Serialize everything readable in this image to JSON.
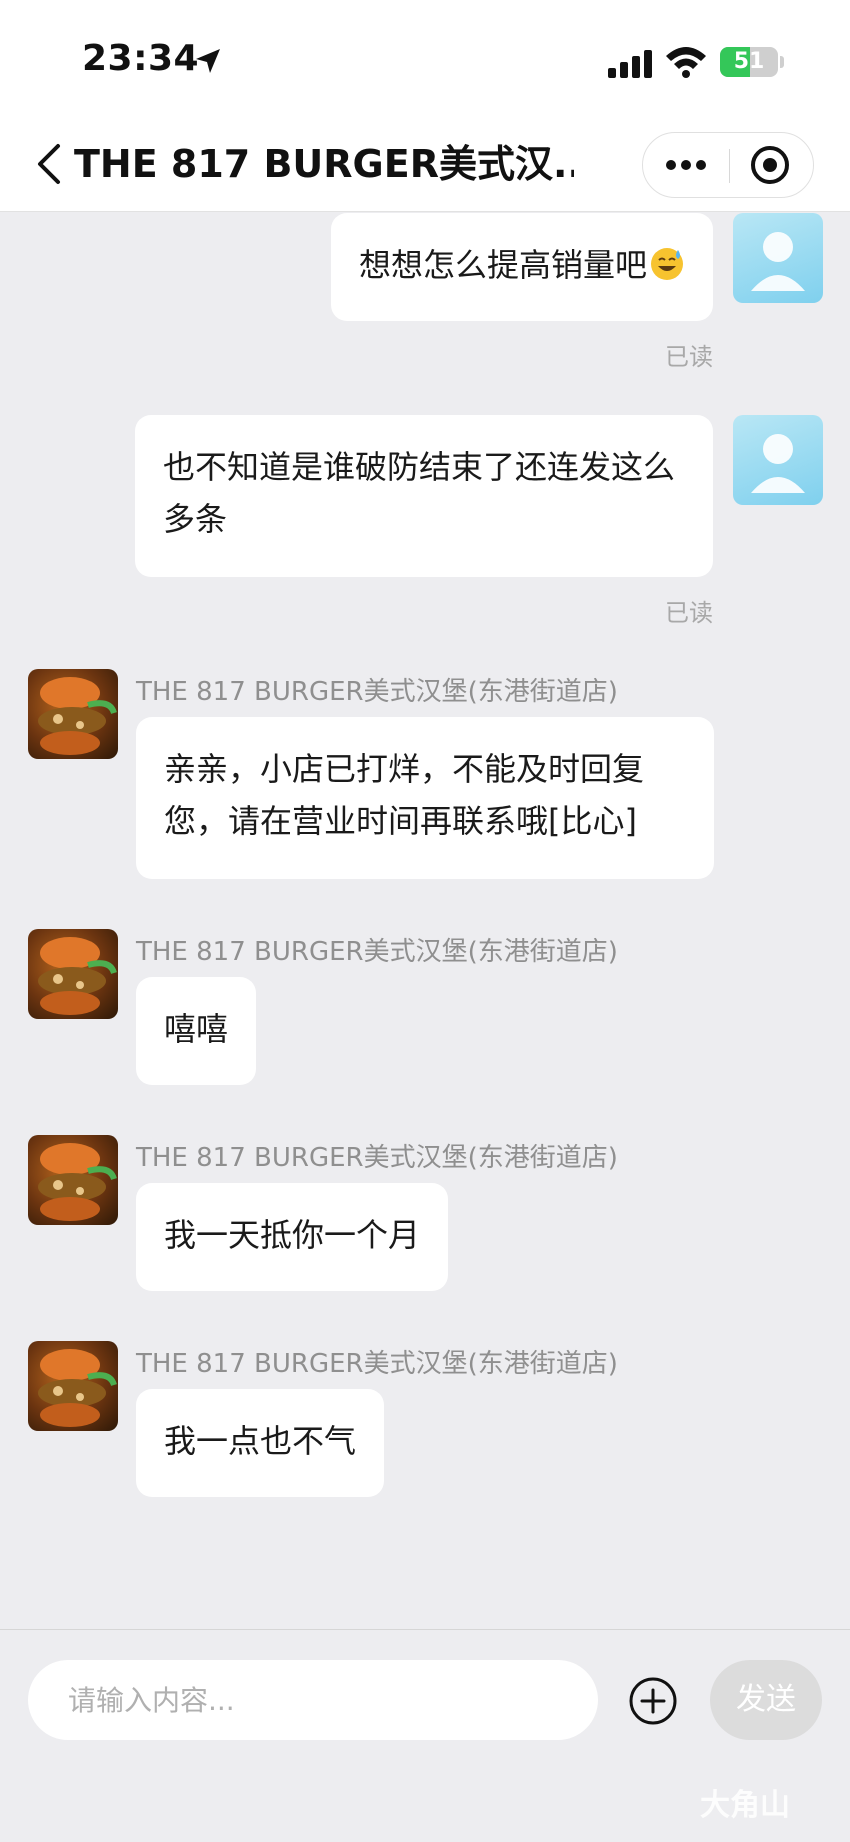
{
  "status_bar": {
    "time": "23:34",
    "battery_percent": "51",
    "battery_level": 0.51
  },
  "nav": {
    "title": "THE 817 BURGER美式汉..."
  },
  "read_label": "已读",
  "messages": [
    {
      "from": "me",
      "text": "想想怎么提高销量吧",
      "emoji": "sweat-smile-icon",
      "read": "已读"
    },
    {
      "from": "me",
      "text": "也不知道是谁破防结束了还连发这么多条",
      "read": "已读"
    },
    {
      "from": "shop",
      "sender": "THE 817 BURGER美式汉堡(东港街道店)",
      "text": "亲亲，小店已打烊，不能及时回复您，请在营业时间再联系哦[比心]"
    },
    {
      "from": "shop",
      "sender": "THE 817 BURGER美式汉堡(东港街道店)",
      "text": "嘻嘻"
    },
    {
      "from": "shop",
      "sender": "THE 817 BURGER美式汉堡(东港街道店)",
      "text": "我一天抵你一个月"
    },
    {
      "from": "shop",
      "sender": "THE 817 BURGER美式汉堡(东港街道店)",
      "text": "我一点也不气"
    }
  ],
  "input": {
    "placeholder": "请输入内容...",
    "value": ""
  },
  "send_label": "发送",
  "watermark": "大角山"
}
